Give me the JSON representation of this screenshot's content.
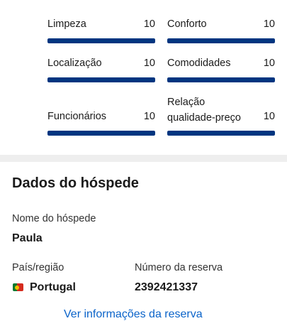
{
  "ratings": [
    {
      "label": "Limpeza",
      "score": "10",
      "fraction": 1.0
    },
    {
      "label": "Conforto",
      "score": "10",
      "fraction": 1.0
    },
    {
      "label": "Localização",
      "score": "10",
      "fraction": 1.0
    },
    {
      "label": "Comodidades",
      "score": "10",
      "fraction": 1.0
    },
    {
      "label": "Funcionários",
      "score": "10",
      "fraction": 1.0
    },
    {
      "label_line1": "Relação",
      "label_line2": "qualidade-preço",
      "score": "10",
      "fraction": 1.0
    }
  ],
  "guest": {
    "section_title": "Dados do hóspede",
    "name_label": "Nome do hóspede",
    "name_value": "Paula",
    "country_label": "País/região",
    "country_value": "Portugal",
    "country_flag_icon": "portugal-flag-icon",
    "booking_label": "Número da reserva",
    "booking_value": "2392421337",
    "link_text": "Ver informações da reserva"
  },
  "colors": {
    "bar_fill": "#003580",
    "link": "#0a63c9"
  }
}
